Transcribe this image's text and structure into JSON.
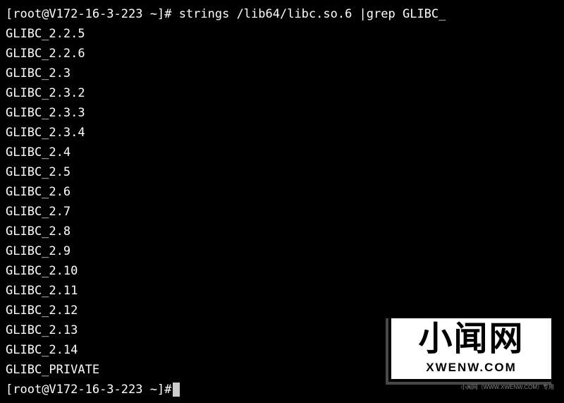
{
  "prompt": {
    "open_bracket": "[",
    "user_host": "root@V172-16-3-223",
    "location": " ~",
    "close_marker": "]#",
    "command": " strings /lib64/libc.so.6 |grep GLIBC_"
  },
  "output_lines": [
    "GLIBC_2.2.5",
    "GLIBC_2.2.6",
    "GLIBC_2.3",
    "GLIBC_2.3.2",
    "GLIBC_2.3.3",
    "GLIBC_2.3.4",
    "GLIBC_2.4",
    "GLIBC_2.5",
    "GLIBC_2.6",
    "GLIBC_2.7",
    "GLIBC_2.8",
    "GLIBC_2.9",
    "GLIBC_2.10",
    "GLIBC_2.11",
    "GLIBC_2.12",
    "GLIBC_2.13",
    "GLIBC_2.14",
    "GLIBC_PRIVATE"
  ],
  "prompt2": {
    "open_bracket": "[",
    "user_host": "root@V172-16-3-223",
    "location": " ~",
    "close_marker": "]#"
  },
  "watermark": {
    "main": "小闻网",
    "sub": "XWENW.COM",
    "footer": "小闻网（WWW.XWENW.COM）专用"
  }
}
